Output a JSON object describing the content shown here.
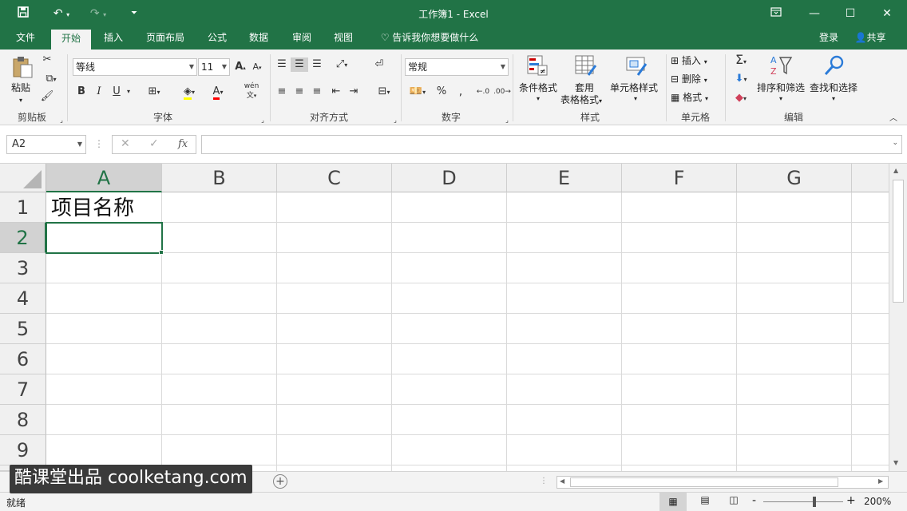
{
  "titlebar": {
    "title": "工作簿1 - Excel",
    "save_icon": "save-icon",
    "undo_icon": "undo-icon",
    "redo_icon": "redo-icon",
    "customize_icon": "customize-icon",
    "ribbon_display_icon": "ribbon-display-icon",
    "minimize": "—",
    "maximize": "☐",
    "close": "✕"
  },
  "menu": {
    "tabs": [
      "文件",
      "开始",
      "插入",
      "页面布局",
      "公式",
      "数据",
      "审阅",
      "视图"
    ],
    "active_tab": "开始",
    "tell_me": "告诉我你想要做什么",
    "login": "登录",
    "share": "共享"
  },
  "ribbon": {
    "groups": [
      "剪贴板",
      "字体",
      "对齐方式",
      "数字",
      "样式",
      "单元格",
      "编辑"
    ],
    "paste_label": "粘贴",
    "font_name": "等线",
    "font_size": "11",
    "bold": "B",
    "italic": "I",
    "underline": "U",
    "font_color_letter": "A",
    "wen_label": "wén",
    "number_format": "常规",
    "percent": "%",
    "conditional_format": "条件格式",
    "table_format_1": "套用",
    "table_format_2": "表格格式",
    "cell_style": "单元格样式",
    "insert": "插入",
    "delete": "删除",
    "format": "格式",
    "sort_filter": "排序和筛选",
    "find_select": "查找和选择",
    "sigma": "Σ"
  },
  "formula_bar": {
    "name_box": "A2",
    "cancel": "✕",
    "enter": "✓",
    "fx": "fx",
    "content": ""
  },
  "sheet": {
    "columns": [
      "A",
      "B",
      "C",
      "D",
      "E",
      "F",
      "G"
    ],
    "rows": [
      "1",
      "2",
      "3",
      "4",
      "5",
      "6",
      "7",
      "8",
      "9"
    ],
    "selected_column": "A",
    "selected_row": "2",
    "cells": {
      "A1": "项目名称"
    }
  },
  "status": {
    "ready": "就绪",
    "zoom": "200%",
    "zoom_minus": "-",
    "zoom_plus": "+"
  },
  "watermark": {
    "text": "酷课堂出品 coolketang.com"
  }
}
